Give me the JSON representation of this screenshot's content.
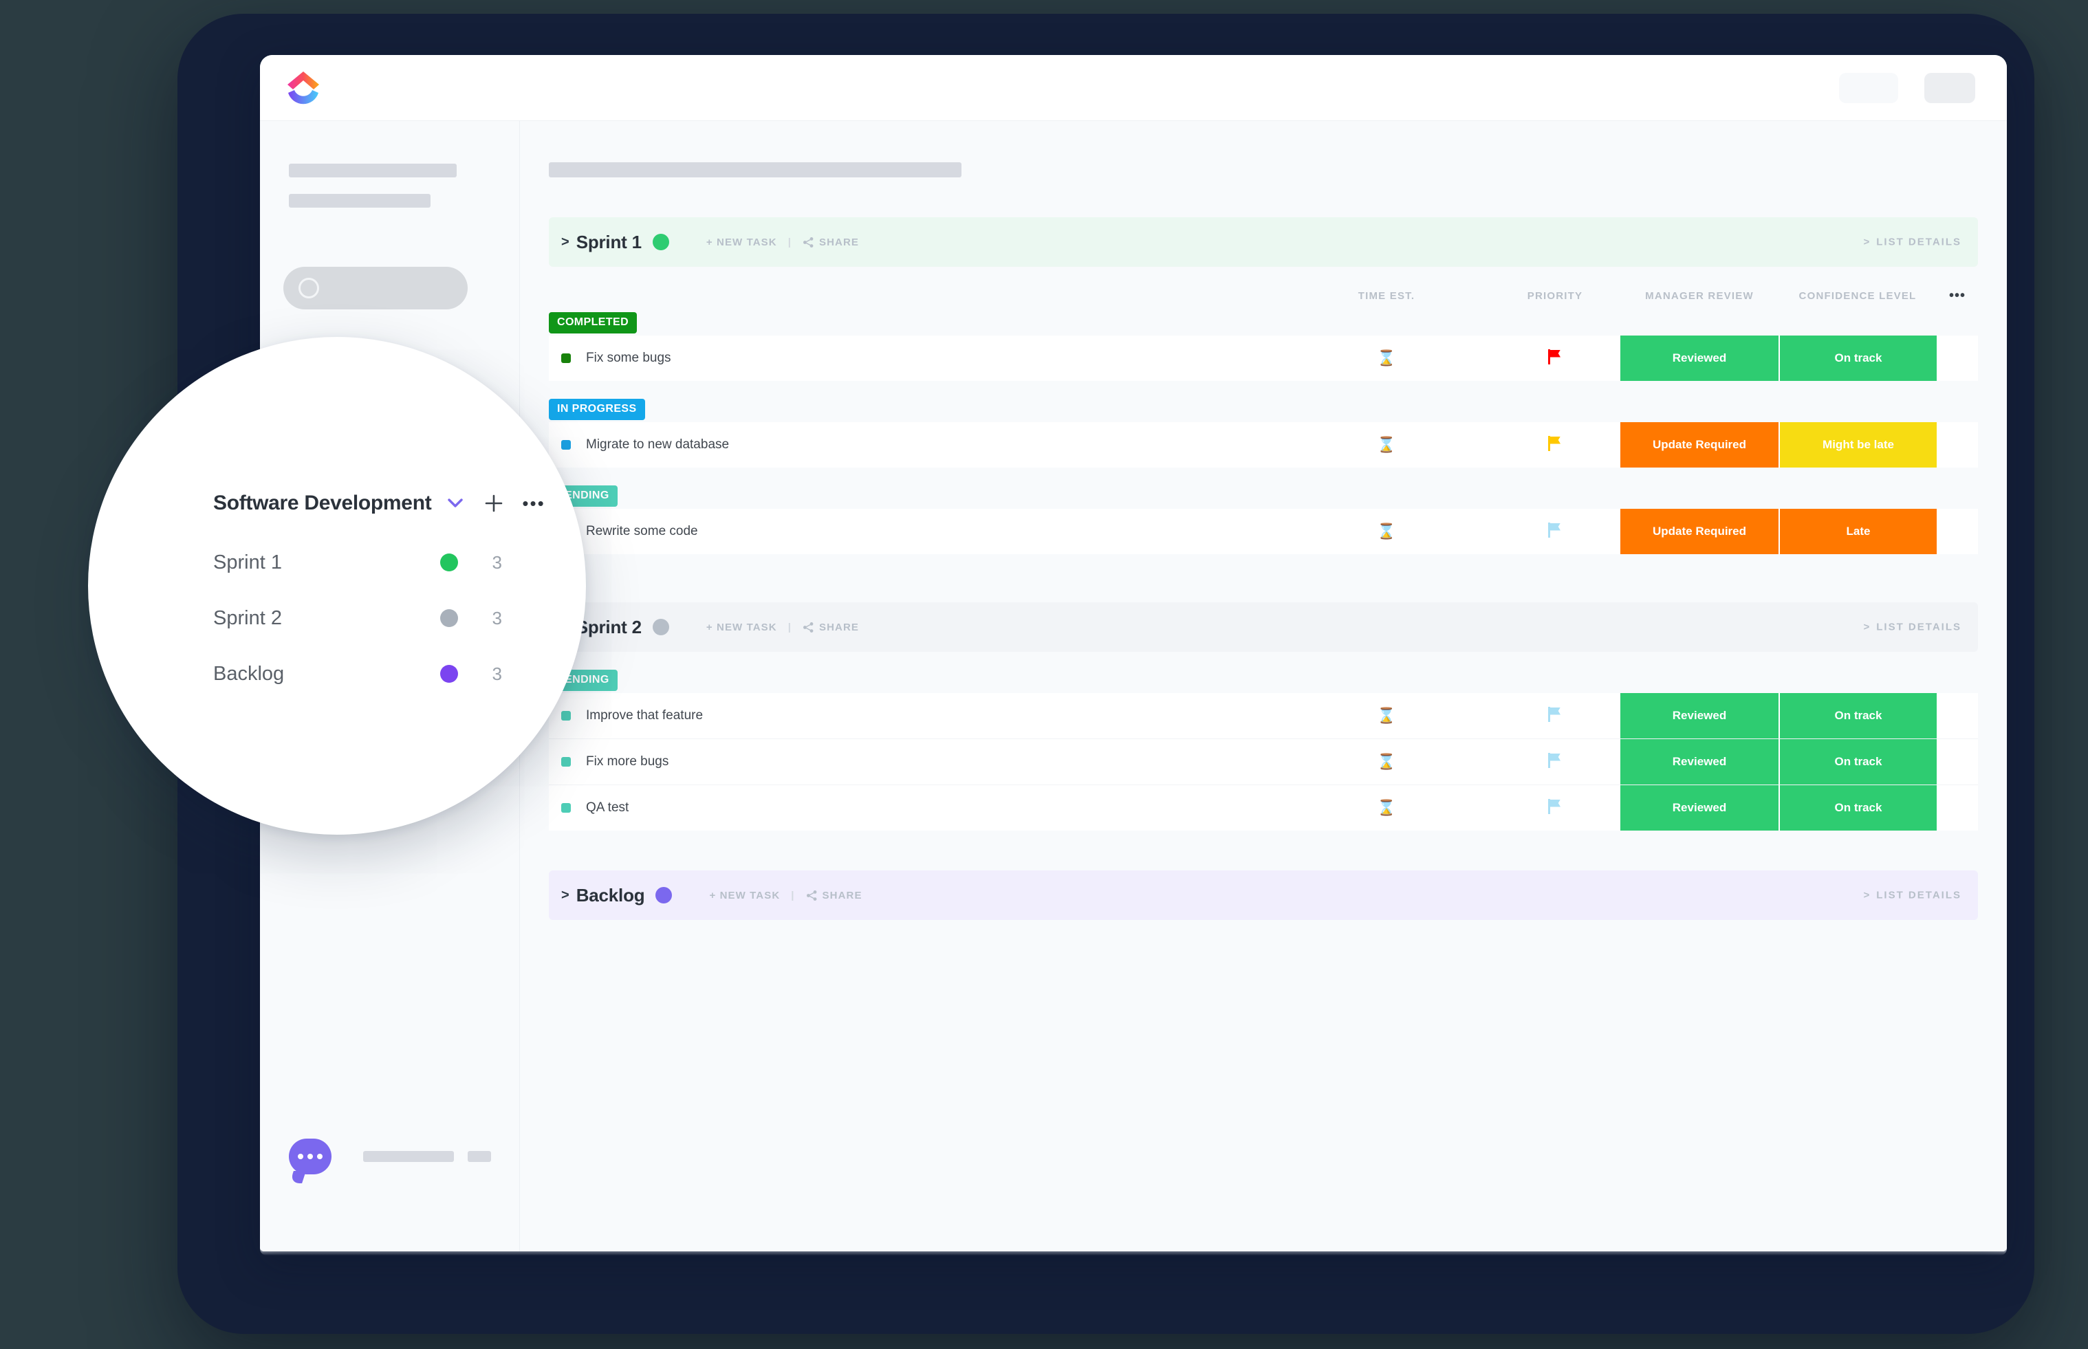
{
  "app": {
    "logo_name": "clickup-logo",
    "window_buttons": [
      "",
      ""
    ]
  },
  "sidebar": {
    "search_placeholder": ""
  },
  "columns": {
    "time_est": "TIME EST.",
    "priority": "PRIORITY",
    "manager_review": "MANAGER REVIEW",
    "confidence_level": "CONFIDENCE LEVEL",
    "more": "•••"
  },
  "actions": {
    "new_task": "+ NEW TASK",
    "separator": "|",
    "share": "SHARE",
    "list_details": "LIST DETAILS",
    "caret": ">",
    "list_details_caret": ">"
  },
  "groups": [
    {
      "title": "Sprint 1",
      "dot_color": "#2ecc71",
      "theme": "green",
      "statuses": [
        {
          "label": "COMPLETED",
          "color": "#109618",
          "tasks": [
            {
              "name": "Fix some bugs",
              "dot_color": "#18820b",
              "time_est": "⌛",
              "priority_color": "#ff0000",
              "manager_review": {
                "text": "Reviewed",
                "color": "#2ecc71"
              },
              "confidence_level": {
                "text": "On track",
                "color": "#2ecc71"
              }
            }
          ]
        },
        {
          "label": "IN PROGRESS",
          "color": "#14a7ea",
          "tasks": [
            {
              "name": "Migrate to new database",
              "dot_color": "#1ba1e2",
              "time_est": "⌛",
              "priority_color": "#ffc800",
              "manager_review": {
                "text": "Update Required",
                "color": "#ff7800"
              },
              "confidence_level": {
                "text": "Might be late",
                "color": "#f7dc12"
              }
            }
          ]
        },
        {
          "label": "PENDING",
          "color": "#4ecdb6",
          "tasks": [
            {
              "name": "Rewrite some code",
              "dot_color": "#4ecdb6",
              "time_est": "⌛",
              "priority_color": "#a9dff5",
              "manager_review": {
                "text": "Update Required",
                "color": "#ff7800"
              },
              "confidence_level": {
                "text": "Late",
                "color": "#ff7800"
              }
            }
          ]
        }
      ]
    },
    {
      "title": "Sprint 2",
      "dot_color": "#b6bec8",
      "theme": "grey",
      "statuses": [
        {
          "label": "PENDING",
          "color": "#4ecdb6",
          "tasks": [
            {
              "name": "Improve that feature",
              "dot_color": "#4ecdb6",
              "time_est": "⌛",
              "priority_color": "#a9dff5",
              "manager_review": {
                "text": "Reviewed",
                "color": "#2ecc71"
              },
              "confidence_level": {
                "text": "On track",
                "color": "#2ecc71"
              }
            },
            {
              "name": "Fix more bugs",
              "dot_color": "#4ecdb6",
              "time_est": "⌛",
              "priority_color": "#a9dff5",
              "manager_review": {
                "text": "Reviewed",
                "color": "#2ecc71"
              },
              "confidence_level": {
                "text": "On track",
                "color": "#2ecc71"
              }
            },
            {
              "name": "QA test",
              "dot_color": "#4ecdb6",
              "time_est": "⌛",
              "priority_color": "#a9dff5",
              "manager_review": {
                "text": "Reviewed",
                "color": "#2ecc71"
              },
              "confidence_level": {
                "text": "On track",
                "color": "#2ecc71"
              }
            }
          ]
        }
      ]
    },
    {
      "title": "Backlog",
      "dot_color": "#7b68ee",
      "theme": "purple",
      "statuses": []
    }
  ],
  "magnifier": {
    "space_title": "Software Development",
    "chevron_icon": "chevron-down",
    "plus_icon": "plus",
    "ellipsis_icon": "•••",
    "lists": [
      {
        "label": "Sprint 1",
        "dot_color": "#22c55e",
        "count": "3"
      },
      {
        "label": "Sprint 2",
        "dot_color": "#a8b0ba",
        "count": "3"
      },
      {
        "label": "Backlog",
        "dot_color": "#7b44f0",
        "count": "3"
      }
    ]
  }
}
